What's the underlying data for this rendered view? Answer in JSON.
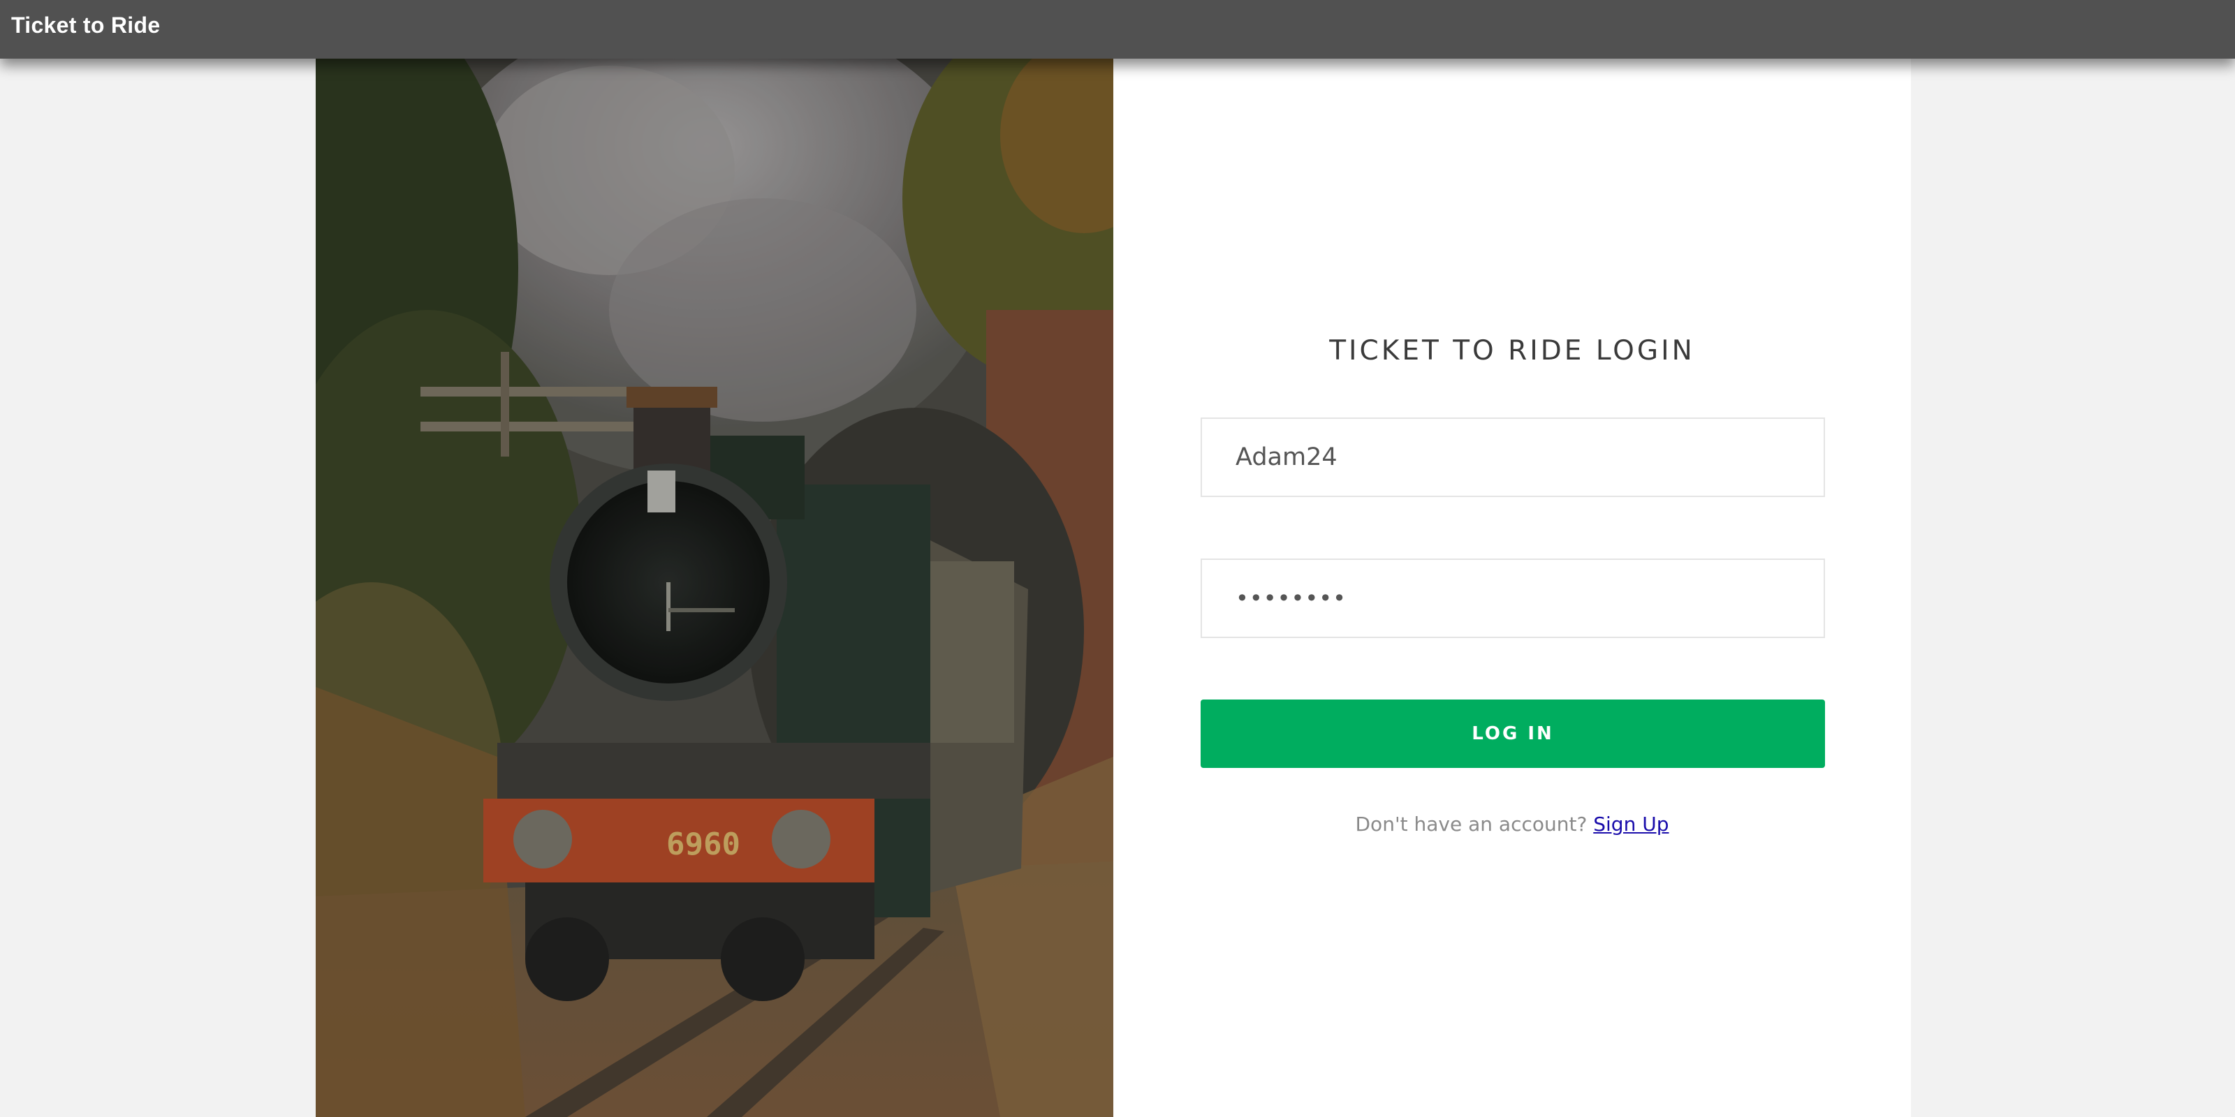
{
  "app": {
    "title": "Ticket to Ride"
  },
  "login": {
    "heading": "TICKET TO RIDE LOGIN",
    "username_value": "Adam24",
    "password_value": "••••••••",
    "login_button": "LOG IN",
    "signup_prompt": "Don't have an account?",
    "signup_link": "Sign Up"
  },
  "photo": {
    "locomotive_number": "6960"
  },
  "colors": {
    "topbar": "#515151",
    "login_button": "#00ad5f",
    "link": "#1a0dab"
  }
}
